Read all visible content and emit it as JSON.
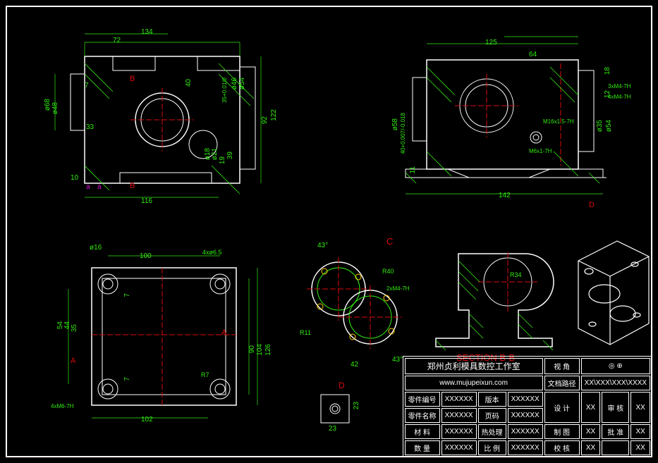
{
  "views": {
    "top_left": {
      "dims": {
        "d134": "134",
        "d72": "72",
        "d7": "7",
        "d33": "33",
        "d68": "ø68",
        "d48": "ø48",
        "d40": "40",
        "d10": "10",
        "d116": "116",
        "d122": "122",
        "d92": "92",
        "d39": "39",
        "d19": "19",
        "d18": "ø18",
        "d21": "ø21",
        "d46": "ø46",
        "d54": "ø54",
        "tol": "35+0.01/0"
      },
      "markers": {
        "B1": "B",
        "B2": "B",
        "a1": "a",
        "a2": "a"
      }
    },
    "top_right": {
      "dims": {
        "d125": "125",
        "d64": "64",
        "d18": "18",
        "d12": "12",
        "d058": "ø58",
        "d035": "ø35",
        "d054": "ø54",
        "d11": "11",
        "d142": "142",
        "tol40": "40+0.007/-0.018"
      },
      "notes": {
        "n1": "3xM4-7H",
        "n2": "4xM4-7H",
        "n3": "M16x1.5-7H",
        "n4": "M6x1-7H"
      },
      "markers": {
        "D": "D"
      }
    },
    "bottom_left": {
      "dims": {
        "d100": "100",
        "d16": "ø16",
        "d54": "54",
        "d44": "44",
        "d35": "35",
        "d7a": "7",
        "d7b": "7",
        "d102": "102",
        "d90": "90",
        "d104": "104",
        "d126": "126",
        "r7": "R7"
      },
      "notes": {
        "n1": "4xø6.5",
        "n2": "4xM6-7H"
      },
      "markers": {
        "A1": "A",
        "A2": "A"
      }
    },
    "detail_c": {
      "label": "C",
      "dims": {
        "a43": "43°",
        "r40": "R40",
        "r11": "R11",
        "d42": "42",
        "a43b": "43°"
      },
      "notes": {
        "n1": "2xM4-7H"
      }
    },
    "detail_d": {
      "label": "D",
      "dims": {
        "d23a": "23",
        "d23b": "23"
      }
    },
    "section_bb": {
      "label": "SECTION  B-B",
      "dims": {
        "r34": "R34"
      }
    }
  },
  "titleblock": {
    "company": "郑州贞利模具数控工作室",
    "url": "www.mujupeixun.com",
    "rows": [
      {
        "l1": "零件编号",
        "v1": "XXXXXX",
        "l2": "版本",
        "v2": "XXXXXX"
      },
      {
        "l1": "零件名称",
        "v1": "XXXXXX",
        "l2": "页码",
        "v2": "XXXXXX"
      },
      {
        "l1": "材 料",
        "v1": "XXXXXX",
        "l2": "热处理",
        "v2": "XXXXXX"
      },
      {
        "l1": "数 量",
        "v1": "XXXXXX",
        "l2": "比 例",
        "v2": "XXXXXX"
      }
    ],
    "right": {
      "r0a": "视 角",
      "r0b": "◎ ⊕",
      "r1a": "文档路径",
      "r1b": "XX\\XXX\\XXX\\XXXX",
      "col": [
        {
          "a": "设 计",
          "b": "XX",
          "c": "审 核",
          "d": "XX"
        },
        {
          "a": "制 图",
          "b": "XX",
          "c": "批 准",
          "d": "XX"
        },
        {
          "a": "校 核",
          "b": "XX",
          "c": "",
          "d": "XX"
        }
      ]
    }
  }
}
